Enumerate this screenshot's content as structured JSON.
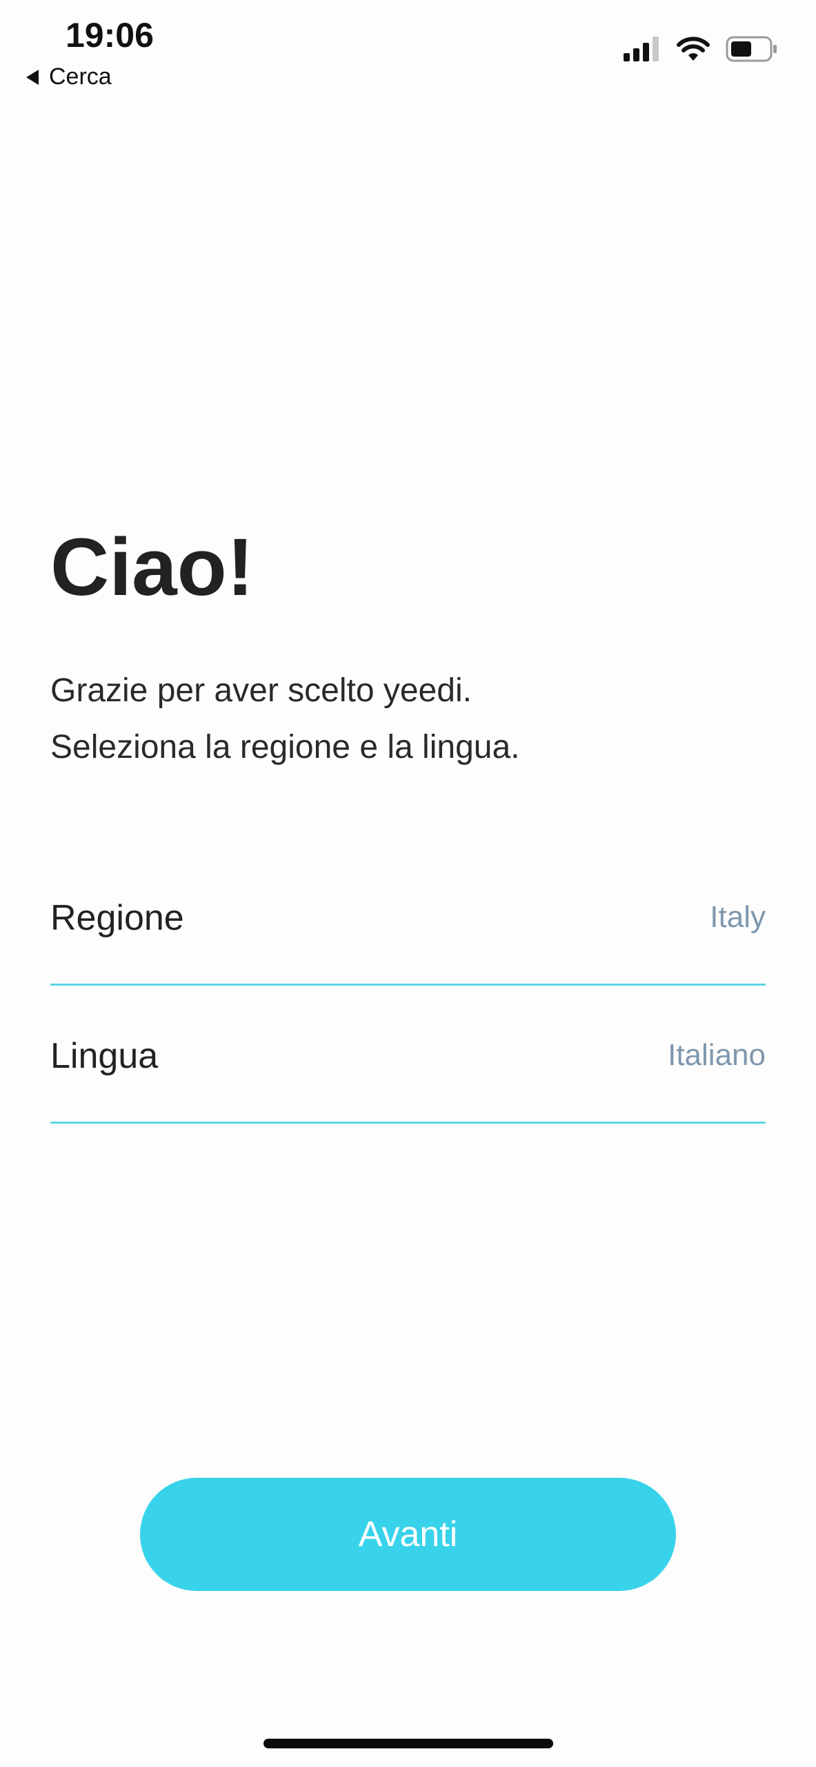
{
  "status_bar": {
    "time": "19:06",
    "back_label": "Cerca",
    "signal_icon": "cellular-signal-icon",
    "wifi_icon": "wifi-icon",
    "battery_icon": "battery-icon",
    "battery_level": 0.55
  },
  "welcome": {
    "title": "Ciao!",
    "subtitle_line1": "Grazie per aver scelto yeedi.",
    "subtitle_line2": "Seleziona la regione e la lingua."
  },
  "settings": {
    "region": {
      "label": "Regione",
      "value": "Italy"
    },
    "language": {
      "label": "Lingua",
      "value": "Italiano"
    }
  },
  "actions": {
    "next_label": "Avanti"
  },
  "colors": {
    "accent": "#38d3ea",
    "divider": "#5ad6e4",
    "value_text": "#7f97ad"
  }
}
